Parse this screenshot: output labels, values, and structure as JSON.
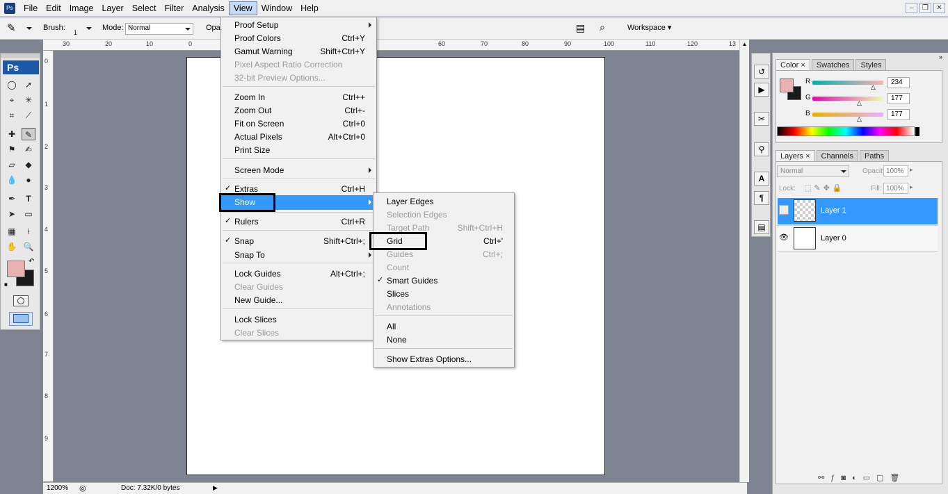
{
  "menubar": {
    "items": [
      "File",
      "Edit",
      "Image",
      "Layer",
      "Select",
      "Filter",
      "Analysis",
      "View",
      "Window",
      "Help"
    ],
    "active": "View"
  },
  "options": {
    "brush_label": "Brush:",
    "brush_size": "1",
    "mode_label": "Mode:",
    "mode_value": "Normal",
    "opacity_label": "Opac",
    "workspace": "Workspace"
  },
  "toolbox": {
    "badge": "Ps"
  },
  "rulers": {
    "h": [
      "30",
      "20",
      "10",
      "0",
      "60",
      "70",
      "80",
      "90",
      "100",
      "110",
      "120",
      "13"
    ],
    "v": [
      "0",
      "1",
      "2",
      "3",
      "4",
      "5",
      "6",
      "7",
      "8",
      "9"
    ]
  },
  "status": {
    "zoom": "1200%",
    "doc": "Doc: 7.32K/0 bytes"
  },
  "view_menu": [
    {
      "label": "Proof Setup",
      "submenu": true
    },
    {
      "label": "Proof Colors",
      "shortcut": "Ctrl+Y"
    },
    {
      "label": "Gamut Warning",
      "shortcut": "Shift+Ctrl+Y"
    },
    {
      "label": "Pixel Aspect Ratio Correction",
      "disabled": true
    },
    {
      "label": "32-bit Preview Options...",
      "disabled": true
    },
    {
      "label": "Zoom In",
      "shortcut": "Ctrl++"
    },
    {
      "label": "Zoom Out",
      "shortcut": "Ctrl+-"
    },
    {
      "label": "Fit on Screen",
      "shortcut": "Ctrl+0"
    },
    {
      "label": "Actual Pixels",
      "shortcut": "Alt+Ctrl+0"
    },
    {
      "label": "Print Size"
    },
    {
      "label": "Screen Mode",
      "submenu": true
    },
    {
      "label": "Extras",
      "shortcut": "Ctrl+H",
      "checked": true
    },
    {
      "label": "Show",
      "submenu": true,
      "highlighted": true
    },
    {
      "label": "Rulers",
      "shortcut": "Ctrl+R",
      "checked": true
    },
    {
      "label": "Snap",
      "shortcut": "Shift+Ctrl+;",
      "checked": true
    },
    {
      "label": "Snap To",
      "submenu": true
    },
    {
      "label": "Lock Guides",
      "shortcut": "Alt+Ctrl+;"
    },
    {
      "label": "Clear Guides",
      "disabled": true
    },
    {
      "label": "New Guide..."
    },
    {
      "label": "Lock Slices"
    },
    {
      "label": "Clear Slices",
      "disabled": true
    }
  ],
  "show_menu": [
    {
      "label": "Layer Edges"
    },
    {
      "label": "Selection Edges",
      "disabled": true
    },
    {
      "label": "Target Path",
      "shortcut": "Shift+Ctrl+H",
      "disabled": true
    },
    {
      "label": "Grid",
      "shortcut": "Ctrl+'"
    },
    {
      "label": "Guides",
      "shortcut": "Ctrl+;",
      "disabled": true
    },
    {
      "label": "Count",
      "disabled": true
    },
    {
      "label": "Smart Guides",
      "checked": true
    },
    {
      "label": "Slices"
    },
    {
      "label": "Annotations",
      "disabled": true
    },
    {
      "label": "All"
    },
    {
      "label": "None"
    },
    {
      "label": "Show Extras Options..."
    }
  ],
  "color_panel": {
    "tabs": [
      "Color",
      "Swatches",
      "Styles"
    ],
    "r_label": "R",
    "g_label": "G",
    "b_label": "B",
    "r": "234",
    "g": "177",
    "b": "177",
    "fg_color": "#eab1b1",
    "bg_color": "#1a1a1a",
    "check": "✓"
  },
  "layers_panel": {
    "tabs": [
      "Layers",
      "Channels",
      "Paths"
    ],
    "blend": "Normal",
    "opacity_label": "Opacity:",
    "opacity": "100%",
    "lock_label": "Lock:",
    "fill_label": "Fill:",
    "fill": "100%",
    "layers": [
      {
        "name": "Layer 1",
        "selected": true
      },
      {
        "name": "Layer 0",
        "selected": false
      }
    ]
  },
  "colors": {
    "accent": "#3399ff",
    "menu_highlight": "#3399ff"
  }
}
